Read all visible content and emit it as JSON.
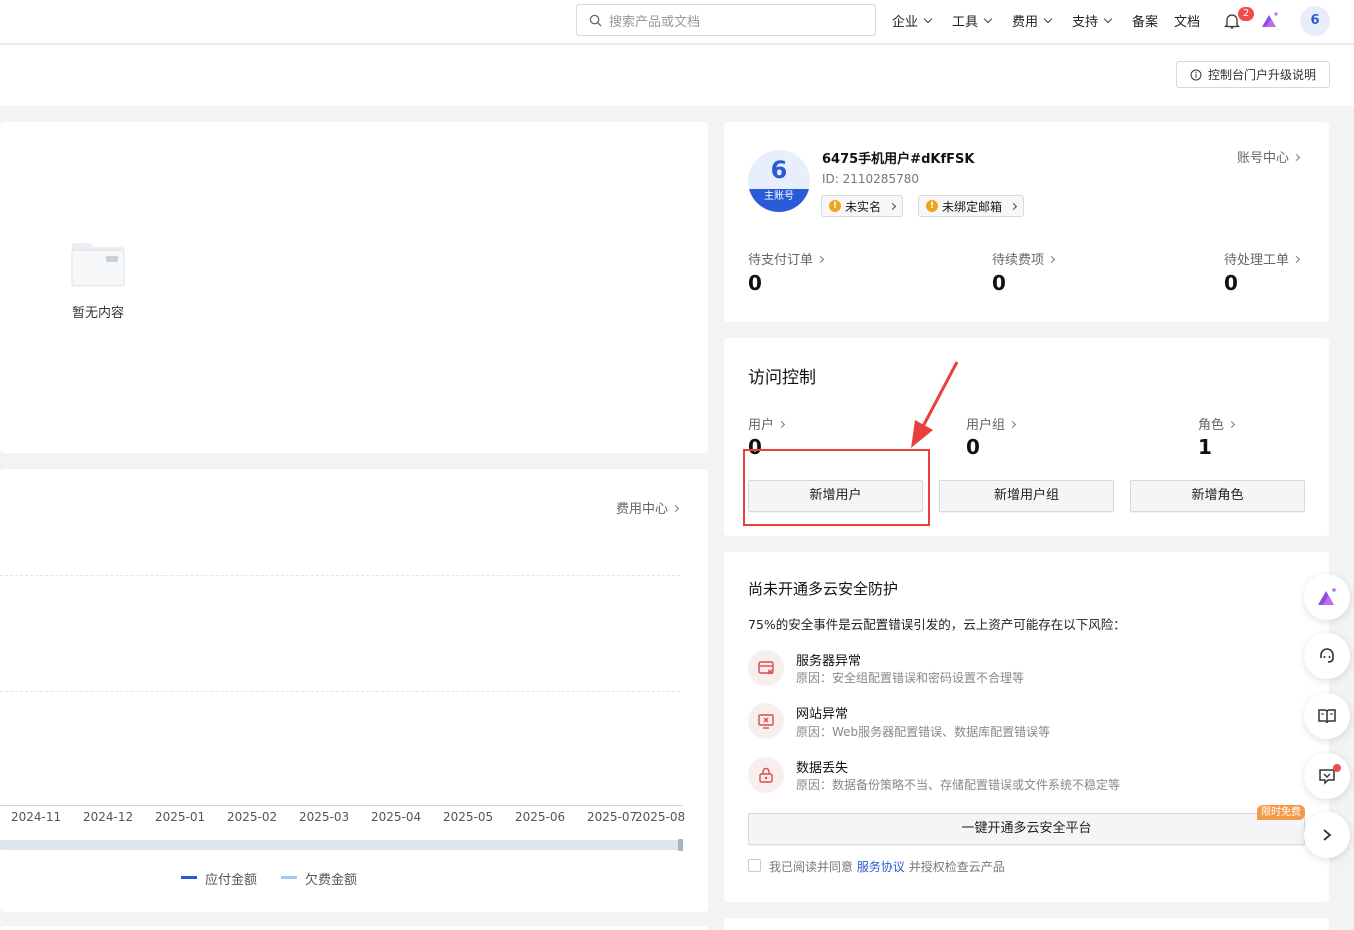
{
  "header": {
    "search_placeholder": "搜索产品或文档",
    "nav": [
      "企业",
      "工具",
      "费用",
      "支持"
    ],
    "links": [
      "备案",
      "文档"
    ],
    "notification_count": "2",
    "avatar_text": "6"
  },
  "upgrade_notice": "控制台门户升级说明",
  "empty_panel": {
    "text": "暂无内容"
  },
  "billing": {
    "link": "费用中心",
    "x_labels": [
      "2024-11",
      "2024-12",
      "2025-01",
      "2025-02",
      "2025-03",
      "2025-04",
      "2025-05",
      "2025-06",
      "2025-07",
      "2025-08"
    ],
    "legend": [
      "应付金额",
      "欠费金额"
    ]
  },
  "account": {
    "avatar_text": "6",
    "avatar_tag": "主账号",
    "name": "6475手机用户#dKfFSK",
    "id": "ID: 2110285780",
    "tags": [
      "未实名",
      "未绑定邮箱"
    ],
    "center_link": "账号中心",
    "stats": [
      {
        "label": "待支付订单",
        "value": "0"
      },
      {
        "label": "待续费项",
        "value": "0"
      },
      {
        "label": "待处理工单",
        "value": "0"
      }
    ]
  },
  "access": {
    "title": "访问控制",
    "stats": [
      {
        "label": "用户",
        "value": "0"
      },
      {
        "label": "用户组",
        "value": "0"
      },
      {
        "label": "角色",
        "value": "1"
      }
    ],
    "buttons": [
      "新增用户",
      "新增用户组",
      "新增角色"
    ]
  },
  "security": {
    "title": "尚未开通多云安全防护",
    "desc": "75%的安全事件是云配置错误引发的，云上资产可能存在以下风险：",
    "risks": [
      {
        "title": "服务器异常",
        "reason": "原因：安全组配置错误和密码设置不合理等"
      },
      {
        "title": "网站异常",
        "reason": "原因：Web服务器配置错误、数据库配置错误等"
      },
      {
        "title": "数据丢失",
        "reason": "原因：数据备份策略不当、存储配置错误或文件系统不稳定等"
      }
    ],
    "cta": "一键开通多云安全平台",
    "promo": "限时免费",
    "agree_prefix": "我已阅读并同意",
    "agree_link": "服务协议",
    "agree_suffix": "并授权检查云产品"
  },
  "colors": {
    "primary": "#2a5bd7",
    "highlight": "#e8403c",
    "legend_light": "#a9c6f5"
  }
}
